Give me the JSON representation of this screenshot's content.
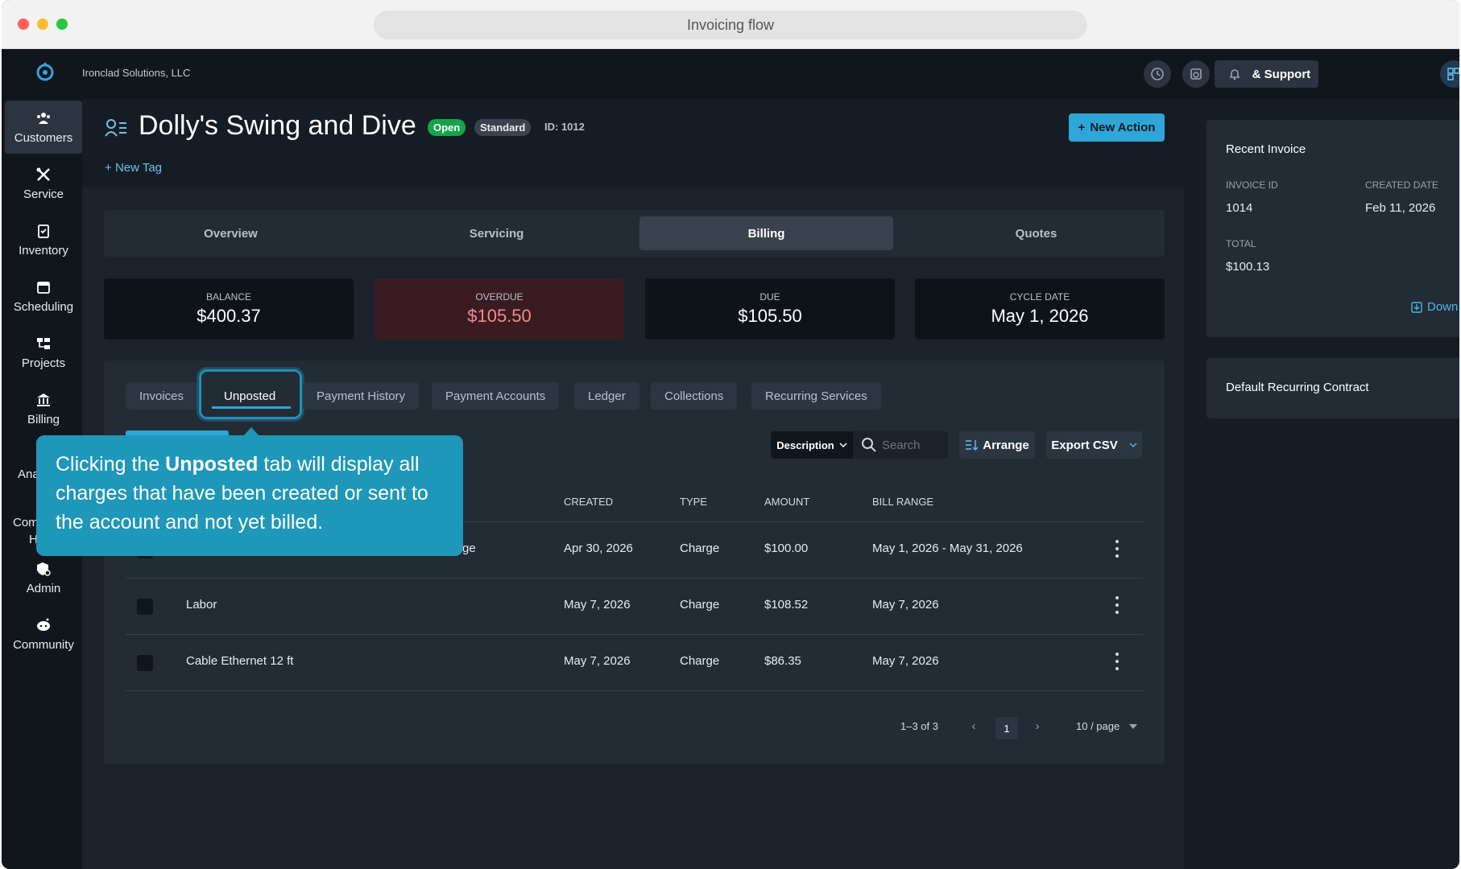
{
  "browser": {
    "title": "Invoicing flow"
  },
  "topbar": {
    "company": "Ironclad Solutions, LLC",
    "help_label": "Help & Support"
  },
  "sidebar": {
    "items": [
      {
        "label": "Customers",
        "icon": "customers-icon"
      },
      {
        "label": "Service",
        "icon": "service-icon"
      },
      {
        "label": "Inventory",
        "icon": "inventory-icon"
      },
      {
        "label": "Scheduling",
        "icon": "calendar-icon"
      },
      {
        "label": "Projects",
        "icon": "projects-icon"
      },
      {
        "label": "Billing",
        "icon": "bank-icon"
      },
      {
        "label": "Ana",
        "icon": "analytics-icon"
      },
      {
        "label": "Com",
        "icon": "comm-icon"
      },
      {
        "label": "Admin",
        "icon": "admin-icon"
      },
      {
        "label": "Community",
        "icon": "community-icon"
      }
    ],
    "partial_h": "H"
  },
  "customer": {
    "name": "Dolly's Swing and Dive",
    "status": "Open",
    "tier": "Standard",
    "id_label": "ID: 1012",
    "new_tag": "New Tag",
    "new_action": "New Action"
  },
  "main_tabs": [
    "Overview",
    "Servicing",
    "Billing",
    "Quotes"
  ],
  "stats": [
    {
      "label": "BALANCE",
      "value": "$400.37"
    },
    {
      "label": "OVERDUE",
      "value": "$105.50"
    },
    {
      "label": "DUE",
      "value": "$105.50"
    },
    {
      "label": "CYCLE DATE",
      "value": "May 1, 2026"
    }
  ],
  "sub_tabs": [
    "Invoices",
    "Unposted",
    "Payment History",
    "Payment Accounts",
    "Ledger",
    "Collections",
    "Recurring Services"
  ],
  "toolbar": {
    "filter_field": "Description",
    "search_placeholder": "Search",
    "arrange": "Arrange",
    "export": "Export CSV"
  },
  "table": {
    "headers": {
      "created": "CREATED",
      "type": "TYPE",
      "amount": "AMOUNT",
      "bill_range": "BILL RANGE"
    },
    "rows": [
      {
        "description": "ge",
        "created": "Apr 30, 2026",
        "type": "Charge",
        "amount": "$100.00",
        "bill_range": "May 1, 2026 - May 31, 2026"
      },
      {
        "description": "Labor",
        "created": "May 7, 2026",
        "type": "Charge",
        "amount": "$108.52",
        "bill_range": "May 7, 2026"
      },
      {
        "description": "Cable Ethernet 12 ft",
        "created": "May 7, 2026",
        "type": "Charge",
        "amount": "$86.35",
        "bill_range": "May 7, 2026"
      }
    ]
  },
  "pagination": {
    "summary": "1–3 of 3",
    "current_page": "1",
    "page_size": "10 / page"
  },
  "recent_invoice": {
    "title": "Recent Invoice",
    "invoice_id_label": "INVOICE ID",
    "invoice_id": "1014",
    "created_label": "CREATED DATE",
    "created": "Feb 11, 2026",
    "total_label": "TOTAL",
    "total": "$100.13",
    "download": "Down"
  },
  "recurring_contract": {
    "title": "Default Recurring Contract"
  },
  "tooltip": {
    "pre": "Clicking the ",
    "bold": "Unposted",
    "post": " tab will display all charges that have been created or sent to the account and not yet billed."
  }
}
